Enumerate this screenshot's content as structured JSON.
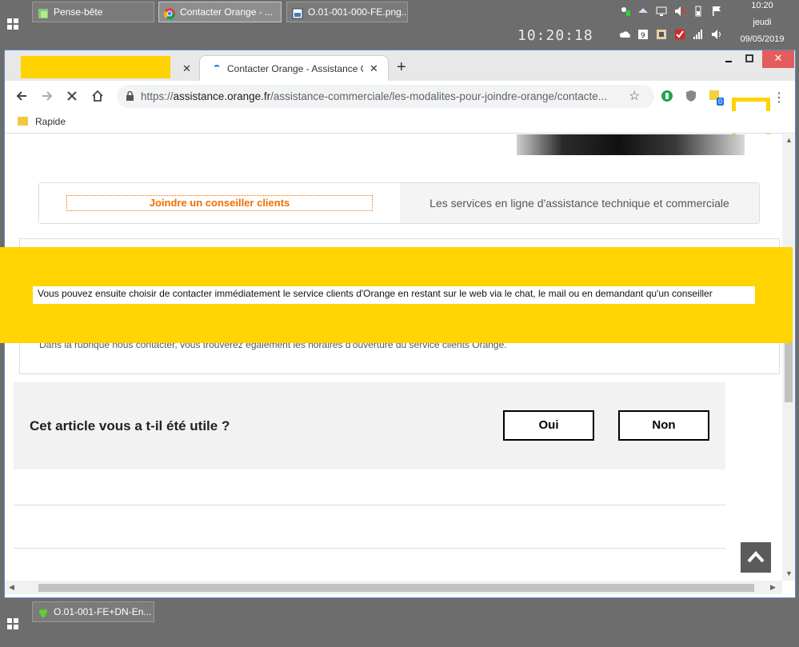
{
  "taskbar_top": {
    "tasks": [
      {
        "label": "Pense-bête"
      },
      {
        "label": "Contacter Orange - ..."
      },
      {
        "label": "O.01-001-000-FE.png..."
      }
    ],
    "big_clock": "10:20:18",
    "tray_time": "10:20",
    "tray_day": "jeudi",
    "tray_date": "09/05/2019"
  },
  "browser": {
    "tab_title": "Contacter Orange - Assistance O",
    "new_tab_symbol": "+",
    "close_symbol": "✕",
    "url_prefix": "https://",
    "url_host": "assistance.orange.fr",
    "url_path": "/assistance-commerciale/les-modalites-pour-joindre-orange/contacte...",
    "bookmark_label": "Rapide",
    "ext_badge": "0"
  },
  "page": {
    "tab_active_label": "Joindre un conseiller clients",
    "tab_other_label": "Les services en ligne d'assistance technique et commerciale",
    "paragraph_1": "Vous pouvez ensuite choisir de contacter immédiatement le service clients d'Orange en restant sur le web via le chat, le mail ou en demandant qu'un conseiller",
    "paragraph_2": "Dans la rubrique nous contacter, vous trouverez également les horaires d'ouverture du service clients Orange.",
    "feedback_question": "Cet article vous a t-il été utile ?",
    "yes_label": "Oui",
    "no_label": "Non"
  },
  "taskbar_bottom": {
    "task_label": "O.01-001-FE+DN-En..."
  },
  "colors": {
    "orange_accent": "#f16e00",
    "redaction_yellow": "#ffd400",
    "taskbar_gray": "#6d6d6d"
  }
}
